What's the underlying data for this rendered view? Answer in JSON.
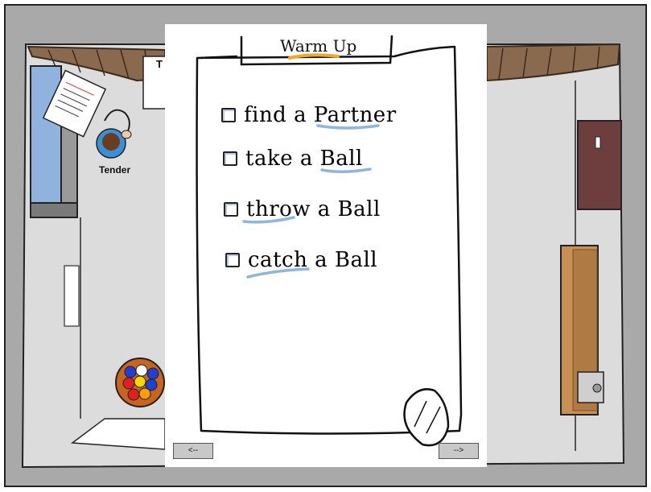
{
  "scene": {
    "npc_label": "Tender",
    "sign_partial": "T",
    "colors": {
      "floor": "#dcdcdc",
      "wall": "#a9a9a9",
      "roof": "#8a6a4f",
      "door_red": "#6e3d3d",
      "door_wood": "#c98f55",
      "ball_tray": "#c8641e"
    }
  },
  "checklist": {
    "title": "Warm Up",
    "tasks": [
      {
        "prefix": "find a ",
        "keyword": "Partner",
        "checked": false
      },
      {
        "prefix": "take a ",
        "keyword": "Ball",
        "checked": false
      },
      {
        "keyword": "throw",
        "suffix": " a Ball",
        "checked": false
      },
      {
        "keyword": "catch",
        "suffix": " a Ball",
        "checked": false
      }
    ],
    "prev_label": "<--",
    "next_label": "-->"
  }
}
